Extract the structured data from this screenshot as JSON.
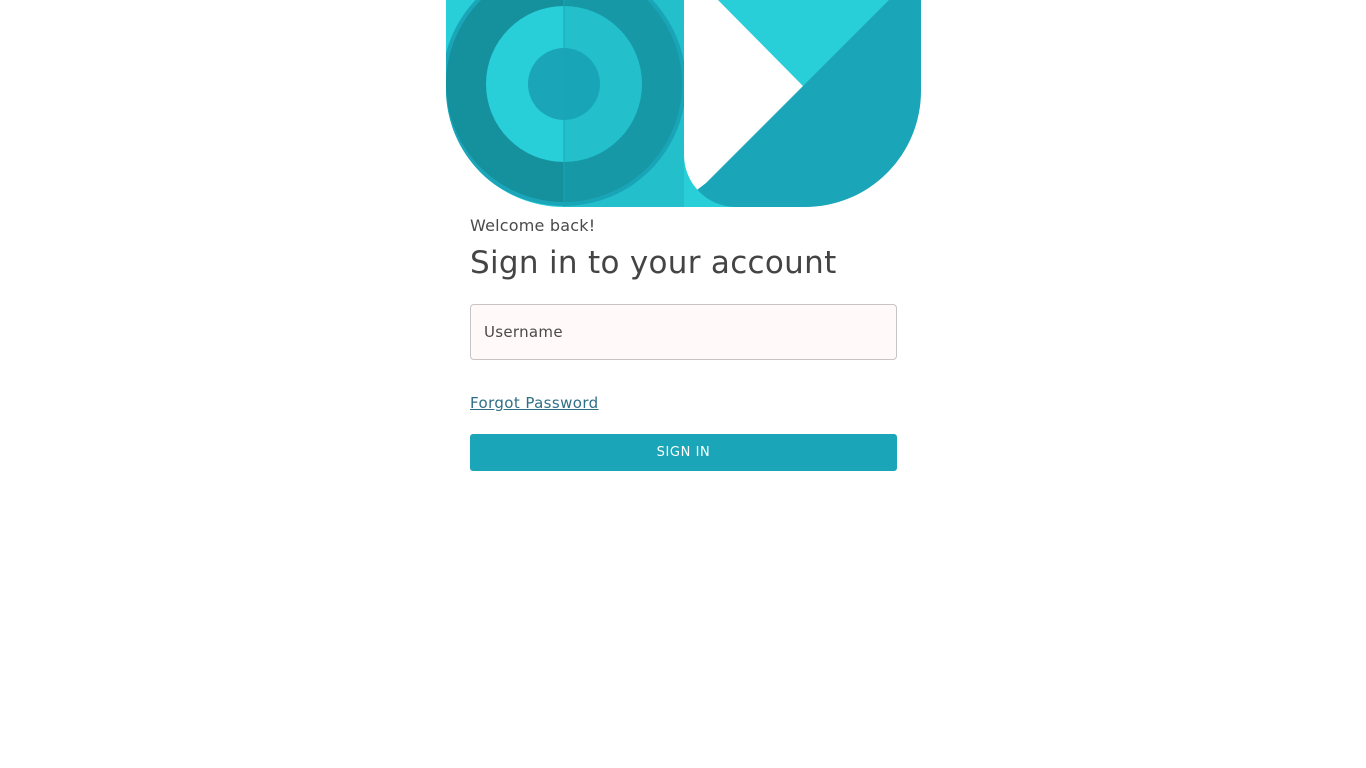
{
  "colors": {
    "brand_primary": "#1aa5b8",
    "brand_light": "#28ced8",
    "brand_dark": "#15919d",
    "link": "#2f6f86",
    "text": "#444444",
    "input_bg": "#fffaf9"
  },
  "hero": {
    "icon": "geometric-brand-illustration"
  },
  "login": {
    "welcome": "Welcome back!",
    "title": "Sign in to your account",
    "username_placeholder": "Username",
    "forgot_password": "Forgot Password",
    "sign_in_label": "SIGN IN"
  }
}
